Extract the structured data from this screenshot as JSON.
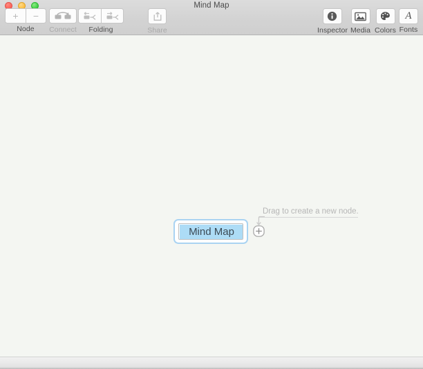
{
  "window": {
    "title": "Mind Map",
    "controls": [
      {
        "name": "close",
        "color": "#fb6158"
      },
      {
        "name": "minimize",
        "color": "#fcbe40"
      },
      {
        "name": "zoom",
        "color": "#3ecf43"
      }
    ]
  },
  "toolbar": {
    "left_groups": [
      {
        "id": "node",
        "label": "Node",
        "enabled": true,
        "buttons": [
          {
            "id": "add-node",
            "icon": "plus-icon",
            "glyph": "+",
            "enabled": false
          },
          {
            "id": "remove-node",
            "icon": "minus-icon",
            "glyph": "−",
            "enabled": false
          }
        ]
      },
      {
        "id": "connect",
        "label": "Connect",
        "enabled": false,
        "buttons": [
          {
            "id": "connect-nodes",
            "icon": "connect-nodes-icon",
            "enabled": false
          }
        ]
      },
      {
        "id": "folding",
        "label": "Folding",
        "enabled": true,
        "buttons": [
          {
            "id": "collapse",
            "icon": "collapse-node-icon",
            "enabled": false
          },
          {
            "id": "expand",
            "icon": "expand-node-icon",
            "enabled": false
          }
        ]
      },
      {
        "id": "share",
        "label": "Share",
        "enabled": false,
        "buttons": [
          {
            "id": "share",
            "icon": "share-icon",
            "enabled": false
          }
        ]
      }
    ],
    "right_groups": [
      {
        "id": "inspector",
        "label": "Inspector",
        "icon": "info-circle-icon"
      },
      {
        "id": "media",
        "label": "Media",
        "icon": "image-icon"
      },
      {
        "id": "colors",
        "label": "Colors",
        "icon": "color-palette-icon"
      },
      {
        "id": "fonts",
        "label": "Fonts",
        "icon": "font-italic-a-icon"
      }
    ]
  },
  "canvas": {
    "node": {
      "text": "Mind Map",
      "selected": true,
      "editing": true,
      "selection_ring_color": "#a9d3f2",
      "text_highlight_color": "#addcf6"
    },
    "hint": {
      "text": "Drag to create a new node.",
      "color": "#b6b6b6",
      "target_icon": "plus-in-circle-icon",
      "arrow_icon": "curved-arrow-down-icon"
    }
  },
  "scrollbar": {
    "orientation": "horizontal"
  }
}
